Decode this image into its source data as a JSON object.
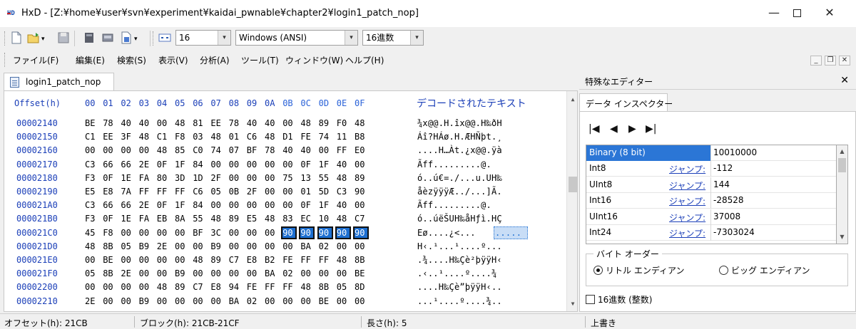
{
  "window": {
    "title": "HxD - [Z:¥home¥user¥svn¥experiment¥kaidai_pwnable¥chapter2¥login1_patch_nop]",
    "icon_text": "HD",
    "min_glyph": "—",
    "close_glyph": "✕"
  },
  "toolbar": {
    "bytes_per_row": "16",
    "charset": "Windows (ANSI)",
    "offset_base": "16進数",
    "arrow_glyph": "▾"
  },
  "menu": [
    "ファイル(F)",
    "編集(E)",
    "検索(S)",
    "表示(V)",
    "分析(A)",
    "ツール(T)",
    "ウィンドウ(W)",
    "ヘルプ(H)"
  ],
  "mdi": {
    "minimize": "_",
    "restore": "❐",
    "close": "✕"
  },
  "doc_tab": {
    "label": "login1_patch_nop"
  },
  "hex": {
    "offset_header": "Offset(h)",
    "columns": [
      "00",
      "01",
      "02",
      "03",
      "04",
      "05",
      "06",
      "07",
      "08",
      "09",
      "0A",
      "0B",
      "0C",
      "0D",
      "0E",
      "0F"
    ],
    "text_header": "デコードされたテキスト",
    "rows": [
      {
        "offset": "00002140",
        "bytes": [
          "BE",
          "78",
          "40",
          "40",
          "00",
          "48",
          "81",
          "EE",
          "78",
          "40",
          "40",
          "00",
          "48",
          "89",
          "F0",
          "48"
        ],
        "text": "¾x@@.H.îx@@.H‰ðH"
      },
      {
        "offset": "00002150",
        "bytes": [
          "C1",
          "EE",
          "3F",
          "48",
          "C1",
          "F8",
          "03",
          "48",
          "01",
          "C6",
          "48",
          "D1",
          "FE",
          "74",
          "11",
          "B8"
        ],
        "text": "Áî?HÁø.H.ÆHÑþt.¸"
      },
      {
        "offset": "00002160",
        "bytes": [
          "00",
          "00",
          "00",
          "00",
          "48",
          "85",
          "C0",
          "74",
          "07",
          "BF",
          "78",
          "40",
          "40",
          "00",
          "FF",
          "E0"
        ],
        "text": "....H…Àt.¿x@@.ÿà"
      },
      {
        "offset": "00002170",
        "bytes": [
          "C3",
          "66",
          "66",
          "2E",
          "0F",
          "1F",
          "84",
          "00",
          "00",
          "00",
          "00",
          "00",
          "0F",
          "1F",
          "40",
          "00"
        ],
        "text": "Ãff.........@."
      },
      {
        "offset": "00002180",
        "bytes": [
          "F3",
          "0F",
          "1E",
          "FA",
          "80",
          "3D",
          "1D",
          "2F",
          "00",
          "00",
          "00",
          "75",
          "13",
          "55",
          "48",
          "89"
        ],
        "text": "ó..ú€=./...u.UH‰"
      },
      {
        "offset": "00002190",
        "bytes": [
          "E5",
          "E8",
          "7A",
          "FF",
          "FF",
          "FF",
          "C6",
          "05",
          "0B",
          "2F",
          "00",
          "00",
          "01",
          "5D",
          "C3",
          "90"
        ],
        "text": "åèzÿÿÿÆ../...]Ã."
      },
      {
        "offset": "000021A0",
        "bytes": [
          "C3",
          "66",
          "66",
          "2E",
          "0F",
          "1F",
          "84",
          "00",
          "00",
          "00",
          "00",
          "00",
          "0F",
          "1F",
          "40",
          "00"
        ],
        "text": "Ãff.........@."
      },
      {
        "offset": "000021B0",
        "bytes": [
          "F3",
          "0F",
          "1E",
          "FA",
          "EB",
          "8A",
          "55",
          "48",
          "89",
          "E5",
          "48",
          "83",
          "EC",
          "10",
          "48",
          "C7"
        ],
        "text": "ó..úëŠUH‰åHƒì.HÇ"
      },
      {
        "offset": "000021C0",
        "bytes": [
          "45",
          "F8",
          "00",
          "00",
          "00",
          "00",
          "BF",
          "3C",
          "00",
          "00",
          "00",
          "90",
          "90",
          "90",
          "90",
          "90"
        ],
        "text": "Eø....¿<...",
        "sel_start": 11,
        "sel_text": "....."
      },
      {
        "offset": "000021D0",
        "bytes": [
          "48",
          "8B",
          "05",
          "B9",
          "2E",
          "00",
          "00",
          "B9",
          "00",
          "00",
          "00",
          "00",
          "BA",
          "02",
          "00",
          "00"
        ],
        "text": "H‹.¹...¹....º..."
      },
      {
        "offset": "000021E0",
        "bytes": [
          "00",
          "BE",
          "00",
          "00",
          "00",
          "00",
          "48",
          "89",
          "C7",
          "E8",
          "B2",
          "FE",
          "FF",
          "FF",
          "48",
          "8B"
        ],
        "text": ".¾....H‰Çè²þÿÿH‹"
      },
      {
        "offset": "000021F0",
        "bytes": [
          "05",
          "8B",
          "2E",
          "00",
          "00",
          "B9",
          "00",
          "00",
          "00",
          "00",
          "BA",
          "02",
          "00",
          "00",
          "00",
          "BE"
        ],
        "text": ".‹..¹....º....¾"
      },
      {
        "offset": "00002200",
        "bytes": [
          "00",
          "00",
          "00",
          "00",
          "48",
          "89",
          "C7",
          "E8",
          "94",
          "FE",
          "FF",
          "FF",
          "48",
          "8B",
          "05",
          "8D"
        ],
        "text": "....H‰Çè”þÿÿH‹.."
      },
      {
        "offset": "00002210",
        "bytes": [
          "2E",
          "00",
          "00",
          "B9",
          "00",
          "00",
          "00",
          "00",
          "BA",
          "02",
          "00",
          "00",
          "00",
          "BE",
          "00",
          "00"
        ],
        "text": "...¹....º....¾.."
      }
    ]
  },
  "panel": {
    "title": "特殊なエディター",
    "close_glyph": "✕",
    "tab": "データ インスペクター",
    "nav": [
      "|◀",
      "◀",
      "▶",
      "▶|"
    ],
    "rows": [
      {
        "name": "Binary (8 bit)",
        "jump": "",
        "value": "10010000"
      },
      {
        "name": "Int8",
        "jump": "ジャンプ:",
        "value": "-112"
      },
      {
        "name": "UInt8",
        "jump": "ジャンプ:",
        "value": "144"
      },
      {
        "name": "Int16",
        "jump": "ジャンプ:",
        "value": "-28528"
      },
      {
        "name": "UInt16",
        "jump": "ジャンプ:",
        "value": "37008"
      },
      {
        "name": "Int24",
        "jump": "ジャンプ:",
        "value": "-7303024"
      }
    ],
    "byte_order_title": "バイト オーダー",
    "little_endian": "リトル エンディアン",
    "big_endian": "ビッグ エンディアン",
    "hex_checkbox": "16進数 (整数)"
  },
  "status": {
    "offset": "オフセット(h): 21CB",
    "block": "ブロック(h): 21CB-21CF",
    "length": "長さ(h): 5",
    "mode": "上書き"
  },
  "colors": {
    "accent": "#1b3fb8",
    "selection": "#1d6fd1"
  }
}
